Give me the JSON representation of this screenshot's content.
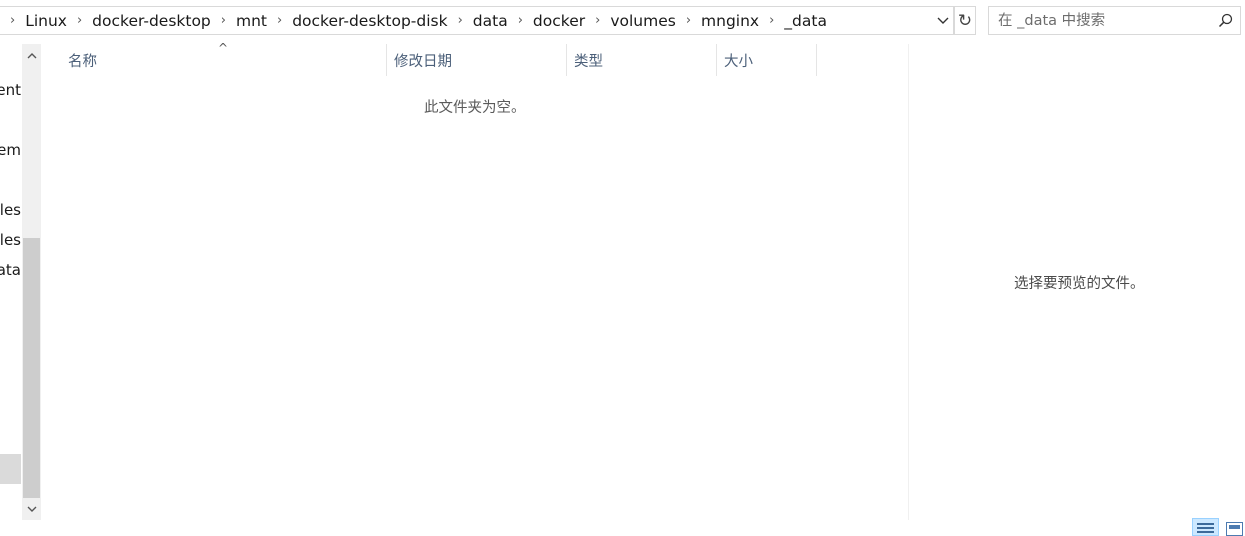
{
  "address_bar": {
    "crumbs": [
      "Linux",
      "docker-desktop",
      "mnt",
      "docker-desktop-disk",
      "data",
      "docker",
      "volumes",
      "mnginx",
      "_data"
    ]
  },
  "search": {
    "placeholder": "在 _data 中搜索"
  },
  "nav_pane": {
    "items": [
      "ent",
      "em",
      "les",
      "les",
      "ata"
    ]
  },
  "columns": {
    "name": "名称",
    "modified": "修改日期",
    "type": "类型",
    "size": "大小"
  },
  "file_list": {
    "empty_message": "此文件夹为空。"
  },
  "preview": {
    "message": "选择要预览的文件。"
  },
  "icons": {
    "chevron": "›",
    "dropdown": "⌵",
    "refresh": "↻",
    "sort_up": "^",
    "scroll_up": "⌃",
    "scroll_down": "⌄"
  }
}
